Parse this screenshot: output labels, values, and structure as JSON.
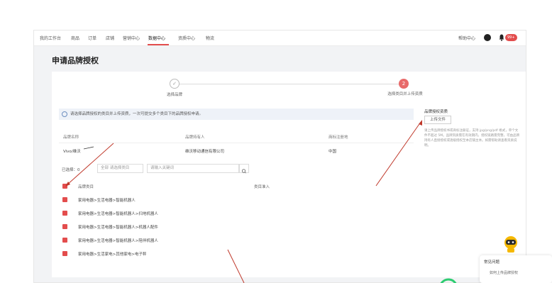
{
  "nav": {
    "items": [
      "我的工作台",
      "商品",
      "订单",
      "店铺",
      "营销中心",
      "数据中心",
      "资质中心",
      "物流"
    ],
    "active_index": 5,
    "help": "帮助中心",
    "badge": "99+"
  },
  "page": {
    "title": "申请品牌授权"
  },
  "steps": [
    {
      "label": "选择品牌",
      "state": "done"
    },
    {
      "label": "选择类目并上传资质",
      "state": "active",
      "number": "2"
    }
  ],
  "notice": "请选择品牌授权的类目并上传资质，一次可提交多个类目下的品牌授权申请。",
  "brand_table": {
    "headers": [
      "品牌名称",
      "品牌持有人",
      "商标注册地"
    ],
    "row": [
      "Vivo/维沃",
      "维沃移动通信有限公司",
      "中国"
    ]
  },
  "filter": {
    "label": "已选择：0",
    "select_prefix": "全部",
    "select_placeholder": "请选择类目",
    "input_placeholder": "请输入关键词"
  },
  "category_table": {
    "headers": [
      "品牌类目",
      "类目准入"
    ],
    "items": [
      "家用电器>生活电器>智能机器人",
      "家用电器>生活电器>智能机器人>扫地机器人",
      "家用电器>生活电器>智能机器人>机器人配件",
      "家用电器>生活电器>智能机器人>陪伴机器人",
      "家用电器>生活家电>其他家电>电子秤"
    ]
  },
  "upload": {
    "title": "品牌授权资质",
    "button": "上传文件",
    "desc": "请上传品牌授权书或商标注册证，支持 jpg/png/pdf 格式，单个文件不超过 5M。品牌资质需在有效期内，授权链路需完整，可由品牌持有人直接授权或逐级授权至本店铺主体。如需帮助请查看资质说明。"
  },
  "popup": {
    "title": "常见问题",
    "item": "如何上传品牌授权"
  }
}
